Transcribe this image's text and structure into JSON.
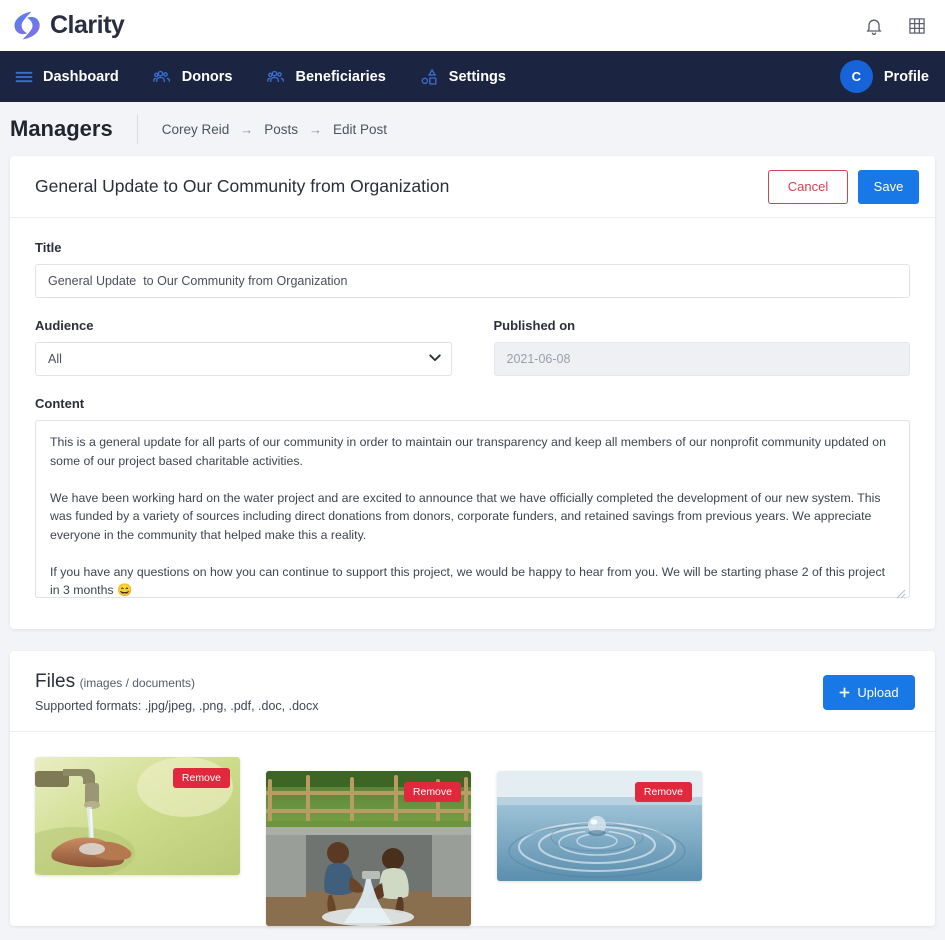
{
  "brand": {
    "name": "Clarity"
  },
  "topbar": {
    "icons": [
      {
        "name": "notification-bell-icon"
      },
      {
        "name": "grid-apps-icon"
      }
    ]
  },
  "nav": {
    "items": [
      {
        "label": "Dashboard",
        "icon": "hamburger-menu-icon"
      },
      {
        "label": "Donors",
        "icon": "people-group-icon"
      },
      {
        "label": "Beneficiaries",
        "icon": "people-group-icon"
      },
      {
        "label": "Settings",
        "icon": "shapes-icon"
      }
    ],
    "profile": {
      "label": "Profile",
      "initial": "C"
    }
  },
  "pagehead": {
    "title": "Managers",
    "breadcrumb": [
      "Corey Reid",
      "Posts",
      "Edit Post"
    ],
    "separator": "→"
  },
  "post": {
    "heading": "General Update to Our Community from Organization",
    "cancel_label": "Cancel",
    "save_label": "Save",
    "title_label": "Title",
    "title_value": "General Update  to Our Community from Organization",
    "audience_label": "Audience",
    "audience_value": "All",
    "audience_options": [
      "All"
    ],
    "published_label": "Published on",
    "published_value": "2021-06-08",
    "content_label": "Content",
    "content_value": "This is a general update for all parts of our community in order to maintain our transparency and keep all members of our nonprofit community updated on some of our project based charitable activities.\n\nWe have been working hard on the water project and are excited to announce that we have officially completed the development of our new system. This was funded by a variety of sources including direct donations from donors, corporate funders, and retained savings from previous years. We appreciate everyone in the community that helped make this a reality.\n\nIf you have any questions on how you can continue to support this project, we would be happy to hear from you. We will be starting phase 2 of this project in 3 months 😄"
  },
  "files": {
    "title": "Files",
    "subtitle": "(images / documents)",
    "formats": "Supported formats: .jpg/jpeg, .png, .pdf, .doc, .docx",
    "upload_label": "Upload",
    "upload_icon": "plus-icon",
    "remove_label": "Remove",
    "items": [
      {
        "name": "tap-water-hands-photo",
        "remove_label": "Remove"
      },
      {
        "name": "boys-at-water-spring-photo",
        "remove_label": "Remove"
      },
      {
        "name": "water-droplet-ripple-photo",
        "remove_label": "Remove"
      }
    ]
  },
  "colors": {
    "navbar": "#1b2440",
    "primary": "#1878e6",
    "danger": "#e0293c",
    "cancel_border": "#d4414f",
    "nav_icon": "#3b6fd4"
  }
}
